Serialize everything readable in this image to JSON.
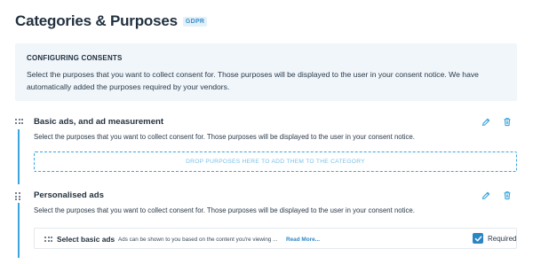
{
  "header": {
    "title": "Categories & Purposes",
    "badge": "GDPR"
  },
  "info": {
    "heading": "CONFIGURING CONSENTS",
    "text": "Select the purposes that you want to collect consent for. Those purposes will be displayed to the user in your consent notice. We have automatically added the purposes required by your vendors."
  },
  "categories": [
    {
      "title": "Basic ads, and ad measurement",
      "description": "Select the purposes that you want to collect consent for. Those purposes will be displayed to the user in your consent notice.",
      "drop_zone": "DROP PURPOSES HERE TO ADD THEM TO THE CATEGORY"
    },
    {
      "title": "Personalised ads",
      "description": "Select the purposes that you want to collect consent for. Those purposes will be displayed to the user in your consent notice.",
      "purposes": [
        {
          "name": "Select basic ads",
          "description": "Ads can be shown to you based on the content you're viewing ...",
          "read_more": "Read More...",
          "required_label": "Required",
          "required": true
        }
      ]
    }
  ],
  "icons": {
    "drag": "drag-handle-icon",
    "edit": "pencil-icon",
    "delete": "trash-icon",
    "check": "checkmark-icon"
  },
  "colors": {
    "accent": "#3aa6dd",
    "link": "#2d86c4",
    "info_bg": "#f0f6fa"
  }
}
